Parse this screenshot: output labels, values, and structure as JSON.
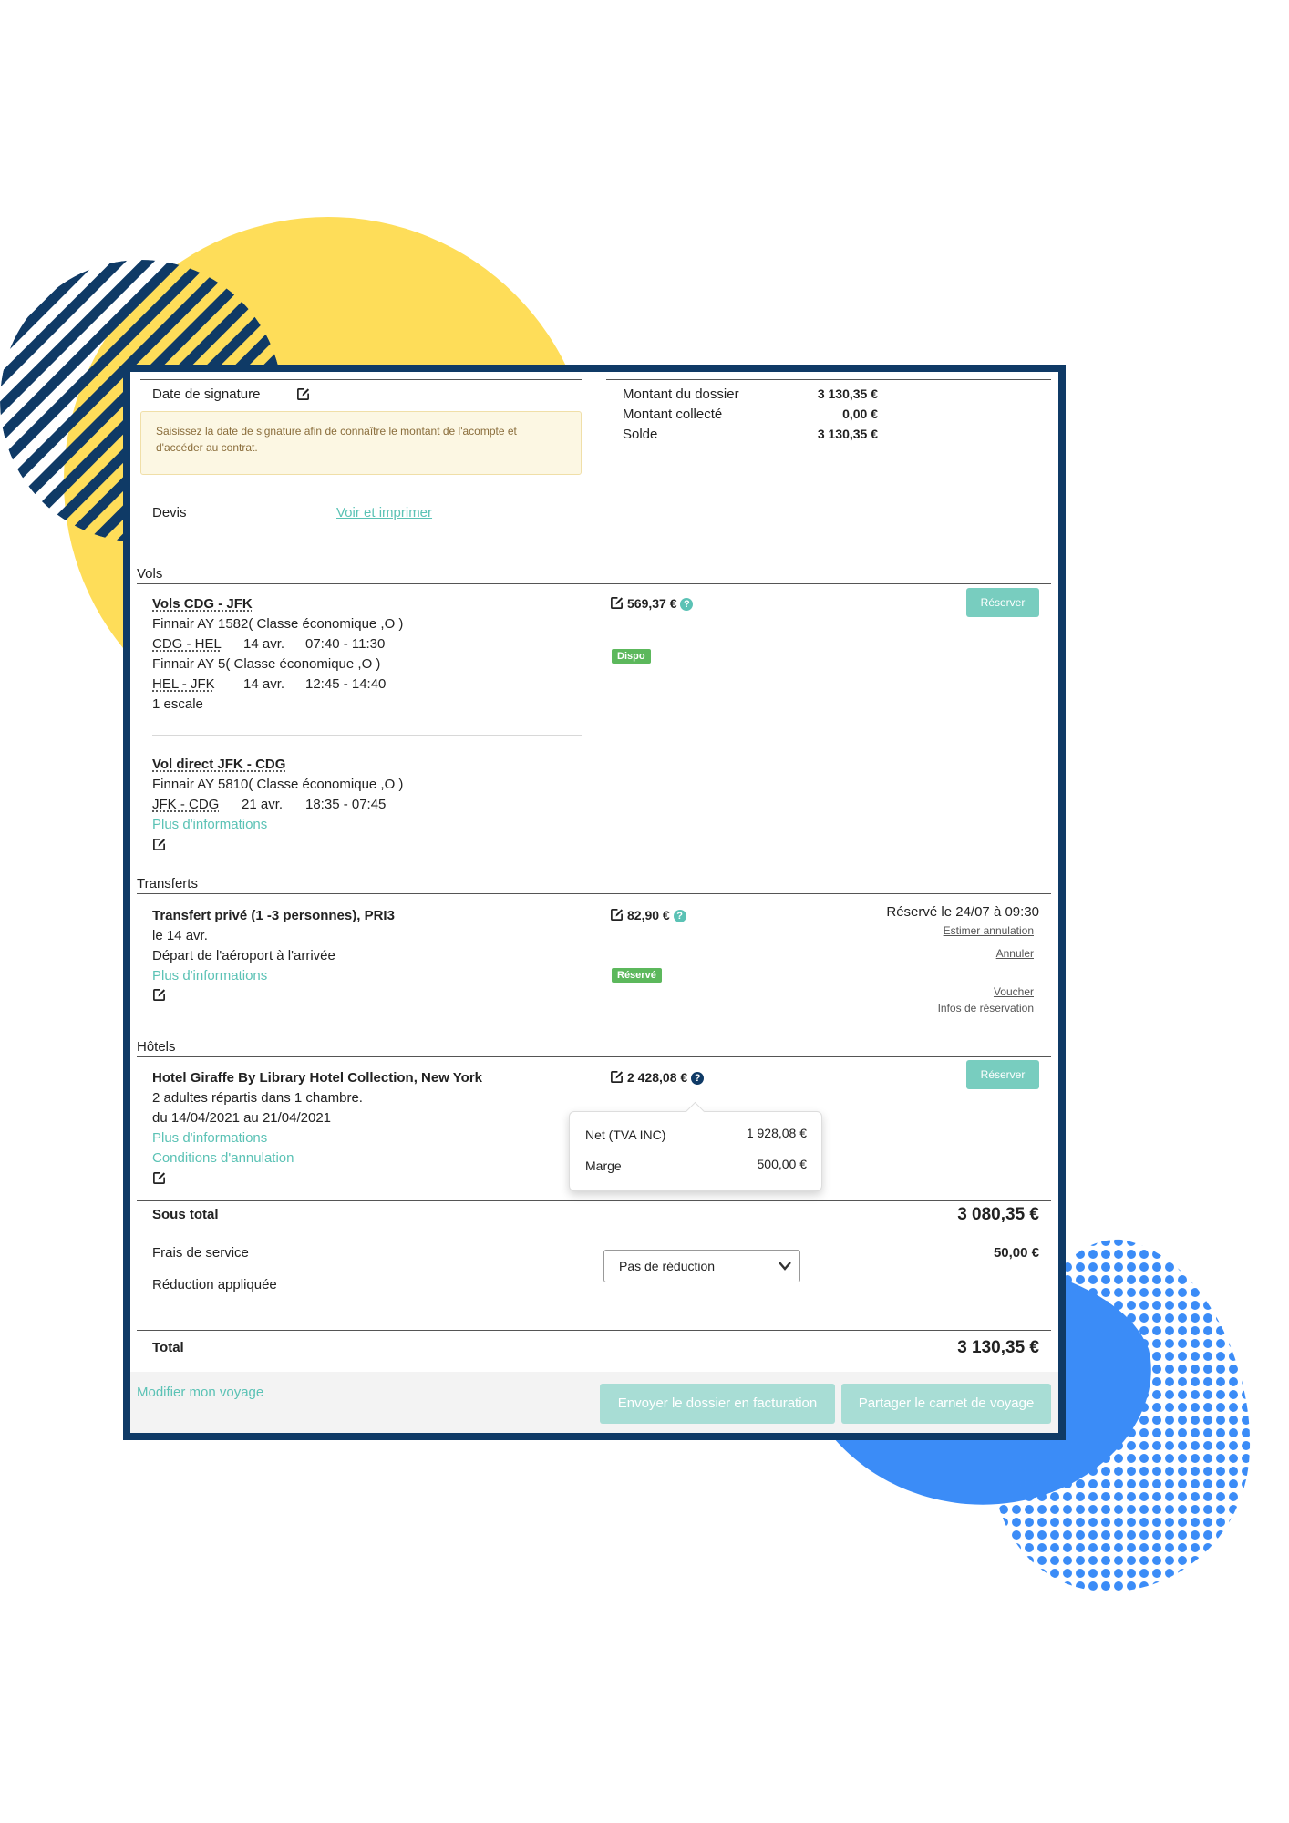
{
  "colors": {
    "frame": "#0f3a66",
    "teal": "#5bc2b5",
    "yellow": "#fedd59",
    "blue": "#3b8cf7",
    "success_green": "#5cb85c"
  },
  "summary": {
    "signature_label": "Date de signature",
    "alert_text": "Saisissez la date de signature afin de connaître le montant de l'acompte et d'accéder au contrat.",
    "devis_label": "Devis",
    "devis_link": "Voir et imprimer",
    "montant_dossier_label": "Montant du dossier",
    "montant_dossier_value": "3 130,35 €",
    "montant_collecte_label": "Montant collecté",
    "montant_collecte_value": "0,00 €",
    "solde_label": "Solde",
    "solde_value": "3 130,35 €"
  },
  "flights": {
    "section_title": "Vols",
    "outbound": {
      "title": "Vols CDG - JFK",
      "leg1_flight": "Finnair AY 1582( Classe économique ,O )",
      "leg1_route": "CDG - HEL",
      "leg1_date": "14 avr.",
      "leg1_time": "07:40 - 11:30",
      "leg2_flight": "Finnair AY 5( Classe économique ,O )",
      "leg2_route": "HEL - JFK",
      "leg2_date": "14 avr.",
      "leg2_time": "12:45 - 14:40",
      "stops": "1 escale"
    },
    "price": "569,37 €",
    "status_badge": "Dispo",
    "reserve_button": "Réserver",
    "return": {
      "title": "Vol direct JFK - CDG",
      "flight": "Finnair AY 5810( Classe économique ,O )",
      "route": "JFK - CDG",
      "date": "21 avr.",
      "time": "18:35 - 07:45",
      "more_info": "Plus d'informations"
    }
  },
  "transfers": {
    "section_title": "Transferts",
    "title": "Transfert privé (1 -3 personnes), PRI3",
    "date": "le 14 avr.",
    "description": "Départ de l'aéroport à l'arrivée",
    "more_info": "Plus d'informations",
    "price": "82,90 €",
    "status_badge": "Réservé",
    "booked_text": "Réservé le 24/07 à 09:30",
    "estimate_link": "Estimer annulation",
    "cancel_link": "Annuler",
    "voucher_link": "Voucher",
    "booking_info": "Infos de réservation"
  },
  "hotels": {
    "section_title": "Hôtels",
    "title": "Hotel Giraffe By Library Hotel Collection, New York",
    "guests": "2 adultes répartis dans 1 chambre.",
    "dates": "du 14/04/2021 au 21/04/2021",
    "more_info": "Plus d'informations",
    "cancellation": "Conditions d'annulation",
    "price": "2 428,08 €",
    "reserve_button": "Réserver",
    "tooltip": {
      "net_label": "Net (TVA INC)",
      "net_value": "1 928,08 €",
      "margin_label": "Marge",
      "margin_value": "500,00 €"
    }
  },
  "totals": {
    "subtotal_label": "Sous total",
    "subtotal_value": "3 080,35 €",
    "fees_label": "Frais de service",
    "fees_value": "50,00 €",
    "discount_label": "Réduction appliquée",
    "discount_selected": "Pas de réduction",
    "total_label": "Total",
    "total_value": "3 130,35 €"
  },
  "footer": {
    "modify_link": "Modifier mon voyage",
    "send_billing_button": "Envoyer le dossier en facturation",
    "share_button": "Partager le carnet de voyage"
  },
  "icons": {
    "edit": "edit-icon",
    "question": "question-circle-icon",
    "chevron": "chevron-down-icon"
  }
}
